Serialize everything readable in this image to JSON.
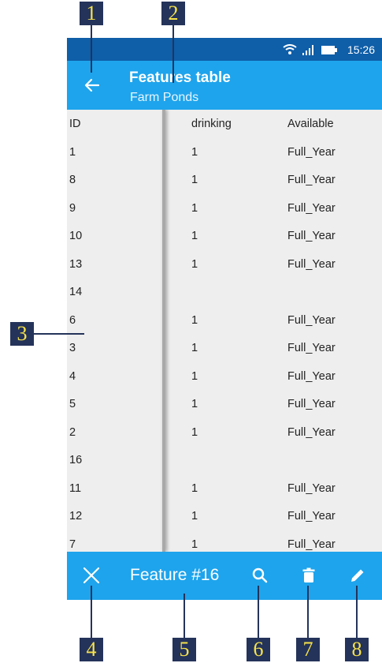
{
  "status_bar": {
    "time": "15:26"
  },
  "app_bar": {
    "title": "Features table",
    "subtitle": "Farm Ponds"
  },
  "table": {
    "columns": [
      "ID",
      "drinking",
      "Available"
    ],
    "rows": [
      [
        "1",
        "1",
        "Full_Year"
      ],
      [
        "8",
        "1",
        "Full_Year"
      ],
      [
        "9",
        "1",
        "Full_Year"
      ],
      [
        "10",
        "1",
        "Full_Year"
      ],
      [
        "13",
        "1",
        "Full_Year"
      ],
      [
        "14",
        "",
        ""
      ],
      [
        "6",
        "1",
        "Full_Year"
      ],
      [
        "3",
        "1",
        "Full_Year"
      ],
      [
        "4",
        "1",
        "Full_Year"
      ],
      [
        "5",
        "1",
        "Full_Year"
      ],
      [
        "2",
        "1",
        "Full_Year"
      ],
      [
        "16",
        "",
        ""
      ],
      [
        "11",
        "1",
        "Full_Year"
      ],
      [
        "12",
        "1",
        "Full_Year"
      ],
      [
        "7",
        "1",
        "Full_Year"
      ]
    ]
  },
  "bottom_bar": {
    "feature_label": "Feature #16"
  },
  "icons": {
    "back": "arrow-left-icon",
    "close": "close-icon",
    "search": "search-icon",
    "delete": "trash-icon",
    "edit": "pencil-icon"
  },
  "callouts": [
    "1",
    "2",
    "3",
    "4",
    "5",
    "6",
    "7",
    "8"
  ],
  "colors": {
    "status_bar": "#0f5ea8",
    "app_bar": "#1ea4ec",
    "table_bg": "#eeeeee",
    "callout_bg": "#24335a",
    "callout_text": "#f6e24a"
  }
}
